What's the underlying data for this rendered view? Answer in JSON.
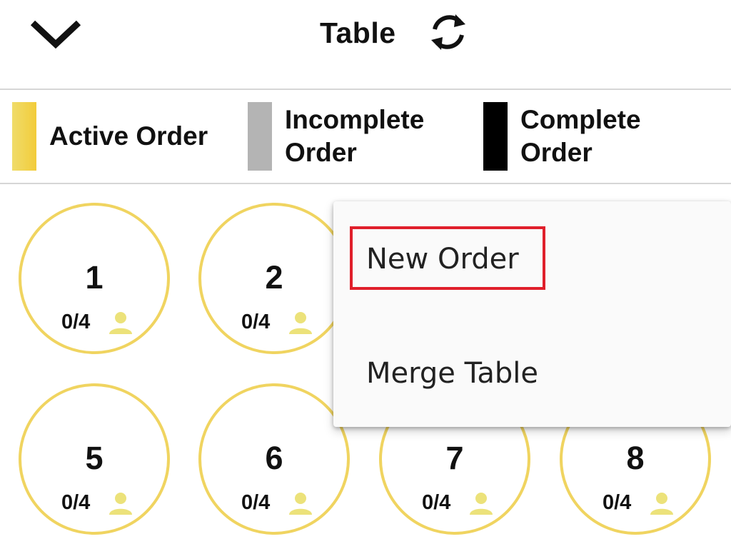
{
  "header": {
    "title": "Table",
    "back_icon": "chevron-down-icon",
    "refresh_icon": "refresh-icon"
  },
  "legend": [
    {
      "label": "Active Order",
      "color": "#f2d44c"
    },
    {
      "label": "Incomplete\nOrder",
      "color": "#b4b4b4"
    },
    {
      "label": "Complete\nOrder",
      "color": "#000000"
    }
  ],
  "tables": [
    {
      "number": "1",
      "capacity": "0/4"
    },
    {
      "number": "2",
      "capacity": "0/4"
    },
    {
      "number": "5",
      "capacity": "0/4"
    },
    {
      "number": "6",
      "capacity": "0/4"
    },
    {
      "number": "7",
      "capacity": "0/4"
    },
    {
      "number": "8",
      "capacity": "0/4"
    }
  ],
  "menu": {
    "items": [
      {
        "label": "New Order"
      },
      {
        "label": "Merge Table"
      }
    ]
  },
  "colors": {
    "active": "#f2d44c",
    "highlight": "#e01f2b"
  }
}
